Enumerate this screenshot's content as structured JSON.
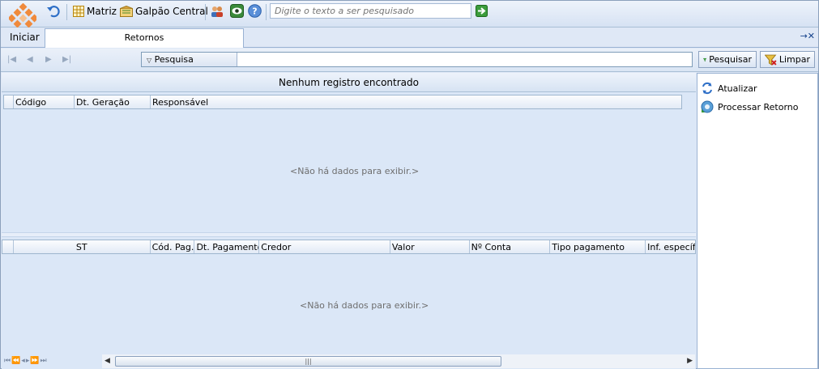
{
  "toolbar": {
    "matriz_label": "Matriz",
    "galpao_label": "Galpão Central",
    "search_placeholder": "Digite o texto a ser pesquisado"
  },
  "tabs": {
    "start_label": "Iniciar",
    "active_tab": "Retornos",
    "controls": "→✕"
  },
  "search_bar": {
    "dropdown_label": "Pesquisa",
    "search_button": "Pesquisar",
    "clear_button": "Limpar"
  },
  "grid1": {
    "caption": "Nenhum registro encontrado",
    "columns": [
      "Código",
      "Dt. Geração",
      "Responsável"
    ],
    "empty_text": "<Não há dados para exibir.>"
  },
  "grid2": {
    "columns": [
      "ST",
      "Cód. Pag.",
      "Dt. Pagamento",
      "Credor",
      "Valor",
      "Nº Conta",
      "Tipo pagamento",
      "Inf. específi"
    ],
    "empty_text": "<Não há dados para exibir.>"
  },
  "footer": {
    "nav_glyphs": "⏮⏪◂▸⏩⏭"
  },
  "side_panel": {
    "items": [
      "Atualizar",
      "Processar Retorno"
    ]
  }
}
